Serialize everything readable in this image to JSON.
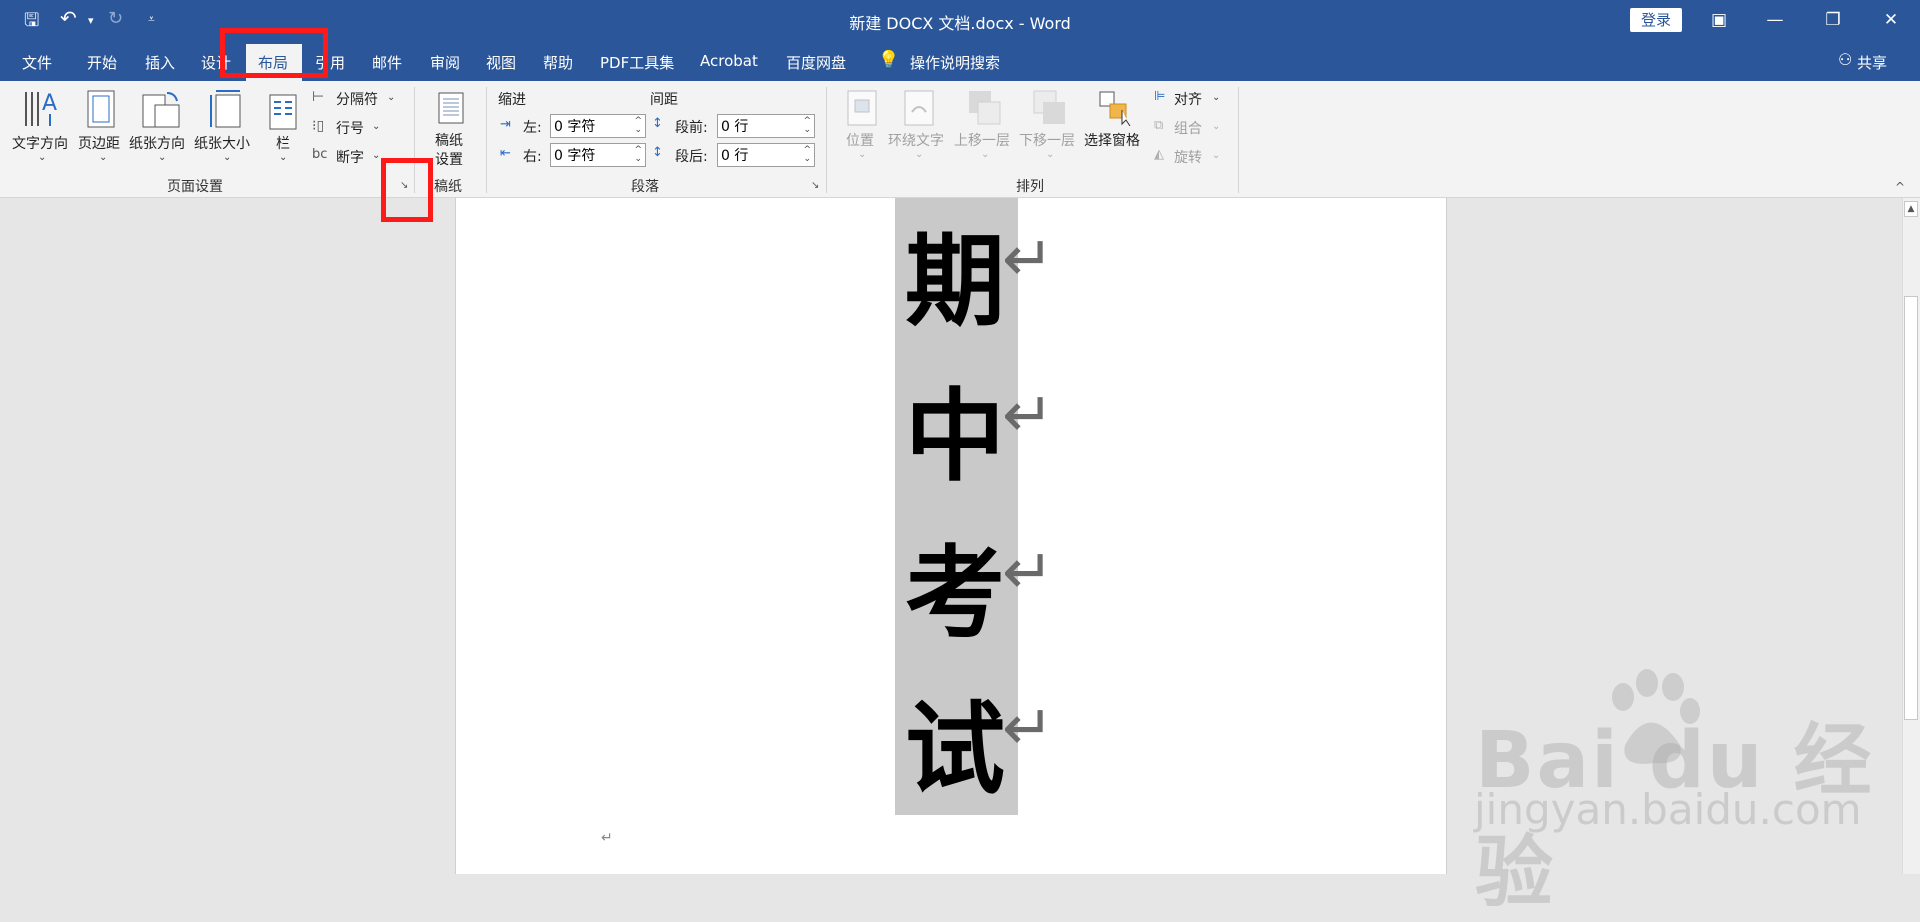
{
  "titlebar": {
    "title": "新建 DOCX 文档.docx  -  Word",
    "login_label": "登录",
    "minimize_glyph": "—",
    "restore_glyph": "❐",
    "close_glyph": "✕",
    "ribbon_display_glyph": "▣"
  },
  "quick_access": {
    "save_glyph": "🖫",
    "undo_glyph": "↶",
    "undo_dropdown_glyph": "▾",
    "redo_glyph": "↻",
    "customize_glyph": "⩡"
  },
  "tabs": [
    "文件",
    "开始",
    "插入",
    "设计",
    "布局",
    "引用",
    "邮件",
    "审阅",
    "视图",
    "帮助",
    "PDF工具集",
    "Acrobat",
    "百度网盘"
  ],
  "tell_me": "操作说明搜索",
  "share": "共享",
  "ribbon": {
    "page_setup": {
      "text_direction": "文字方向",
      "margins": "页边距",
      "orientation": "纸张方向",
      "size": "纸张大小",
      "columns": "栏",
      "breaks": "分隔符",
      "line_numbers": "行号",
      "hyphenation": "断字",
      "group_label": "页面设置",
      "launcher_glyph": "↘"
    },
    "manuscript": {
      "button_line1": "稿纸",
      "button_line2": "设置",
      "group_label": "稿纸"
    },
    "paragraph": {
      "indent_title": "缩进",
      "spacing_title": "间距",
      "left_label": "左:",
      "right_label": "右:",
      "left_value": "0 字符",
      "right_value": "0 字符",
      "before_label": "段前:",
      "after_label": "段后:",
      "before_value": "0 行",
      "after_value": "0 行",
      "group_label": "段落"
    },
    "arrange": {
      "position": "位置",
      "wrap_text": "环绕文字",
      "bring_forward": "上移一层",
      "send_backward": "下移一层",
      "selection_pane": "选择窗格",
      "align": "对齐",
      "group": "组合",
      "rotate": "旋转",
      "group_label": "排列"
    },
    "collapse_glyph": "^"
  },
  "document": {
    "characters": [
      "期",
      "中",
      "考",
      "试"
    ],
    "paragraph_mark": "↵"
  },
  "watermark": {
    "main": "Bai du 经验",
    "url": "jingyan.baidu.com"
  }
}
